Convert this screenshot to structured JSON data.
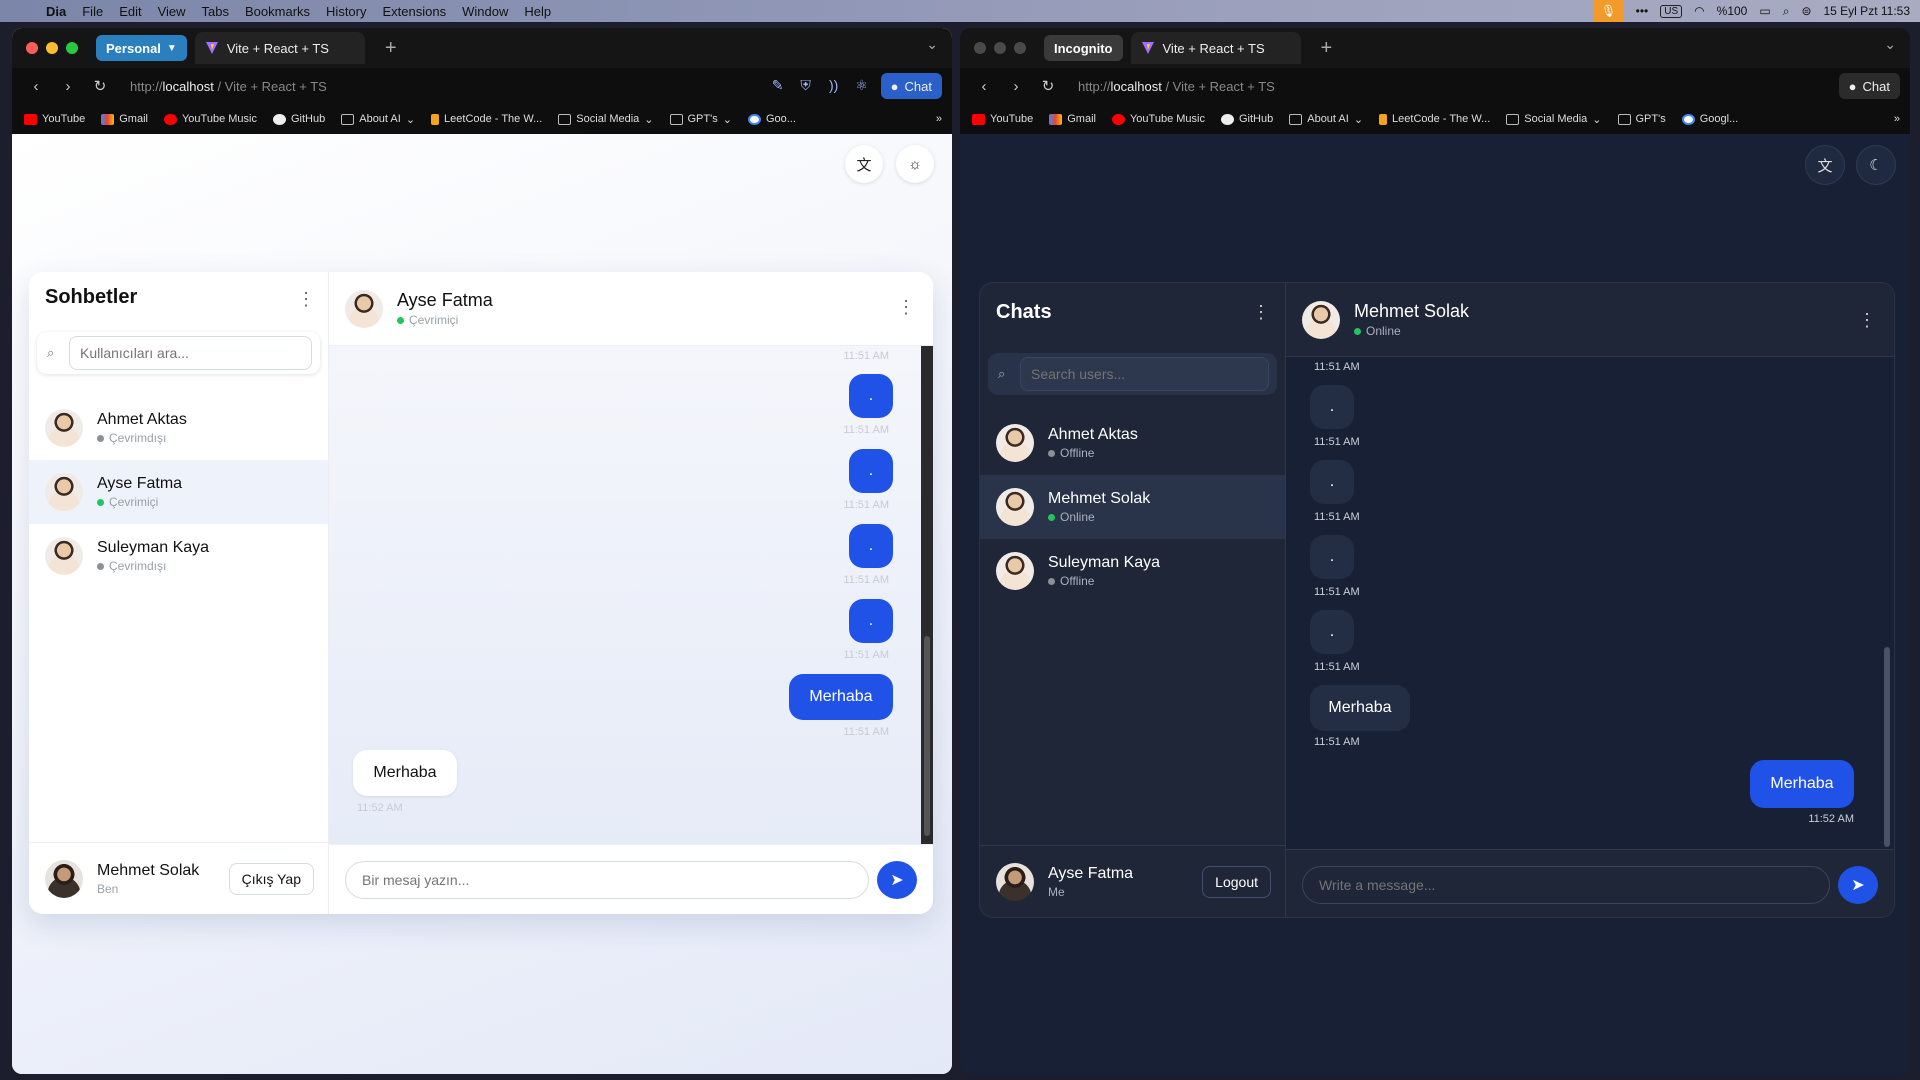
{
  "menubar": {
    "items": [
      "Dia",
      "File",
      "Edit",
      "View",
      "Tabs",
      "Bookmarks",
      "History",
      "Extensions",
      "Window",
      "Help"
    ],
    "keyboard": "US",
    "battery": "%100",
    "datetime": "15 Eyl Pzt  11:53"
  },
  "left_window": {
    "profile": "Personal",
    "tab_title": "Vite + React + TS",
    "url_scheme": "http://",
    "url_host": "localhost",
    "url_title": " / Vite + React + TS",
    "chat_button": "Chat",
    "bookmarks": [
      "YouTube",
      "Gmail",
      "YouTube Music",
      "GitHub",
      "About AI",
      "LeetCode - The W...",
      "Social Media",
      "GPT's",
      "Goo..."
    ],
    "app": {
      "sidebar_title": "Sohbetler",
      "search_placeholder": "Kullanıcıları ara...",
      "users": [
        {
          "name": "Ahmet Aktas",
          "status": "Çevrimdışı"
        },
        {
          "name": "Ayse Fatma",
          "status": "Çevrimiçi"
        },
        {
          "name": "Suleyman Kaya",
          "status": "Çevrimdışı"
        }
      ],
      "me_name": "Mehmet Solak",
      "me_label": "Ben",
      "logout": "Çıkış Yap",
      "chat_name": "Ayse Fatma",
      "chat_status": "Çevrimiçi",
      "messages": [
        {
          "text": ".",
          "time": "11:51 AM"
        },
        {
          "text": ".",
          "time": "11:51 AM"
        },
        {
          "text": ".",
          "time": "11:51 AM"
        },
        {
          "text": ".",
          "time": "11:51 AM"
        },
        {
          "text": "Merhaba",
          "time": "11:51 AM"
        },
        {
          "text": "Merhaba",
          "time": "11:52 AM"
        }
      ],
      "top_time": "11:51 AM",
      "composer_placeholder": "Bir mesaj yazın..."
    }
  },
  "right_window": {
    "profile": "Incognito",
    "tab_title": "Vite + React + TS",
    "url_scheme": "http://",
    "url_host": "localhost",
    "url_title": " / Vite + React + TS",
    "chat_button": "Chat",
    "bookmarks": [
      "YouTube",
      "Gmail",
      "YouTube Music",
      "GitHub",
      "About AI",
      "LeetCode - The W...",
      "Social Media",
      "GPT's",
      "Googl..."
    ],
    "app": {
      "sidebar_title": "Chats",
      "search_placeholder": "Search users...",
      "users": [
        {
          "name": "Ahmet Aktas",
          "status": "Offline"
        },
        {
          "name": "Mehmet Solak",
          "status": "Online"
        },
        {
          "name": "Suleyman Kaya",
          "status": "Offline"
        }
      ],
      "me_name": "Ayse Fatma",
      "me_label": "Me",
      "logout": "Logout",
      "chat_name": "Mehmet Solak",
      "chat_status": "Online",
      "messages": [
        {
          "text": ".",
          "time": "11:51 AM"
        },
        {
          "text": ".",
          "time": "11:51 AM"
        },
        {
          "text": ".",
          "time": "11:51 AM"
        },
        {
          "text": ".",
          "time": "11:51 AM"
        },
        {
          "text": "Merhaba",
          "time": "11:51 AM"
        },
        {
          "text": "Merhaba",
          "time": "11:52 AM"
        }
      ],
      "top_time": "11:51 AM",
      "composer_placeholder": "Write a message..."
    }
  },
  "colors": {
    "accent": "#2152e8",
    "online": "#22c55e",
    "offline": "#9ca3af"
  }
}
